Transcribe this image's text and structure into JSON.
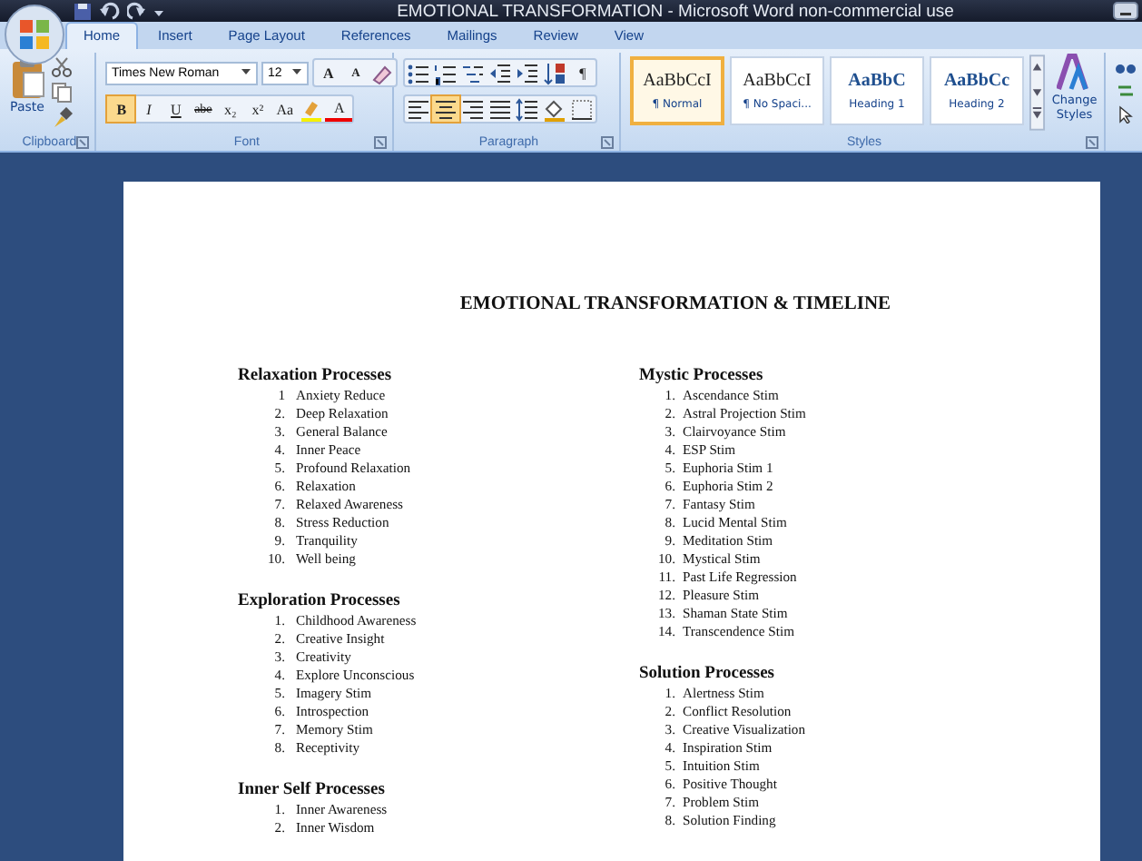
{
  "window": {
    "title": "EMOTIONAL TRANSFORMATION - Microsoft Word non-commercial use"
  },
  "tabs": [
    {
      "label": "Home",
      "selected": true
    },
    {
      "label": "Insert",
      "selected": false
    },
    {
      "label": "Page Layout",
      "selected": false
    },
    {
      "label": "References",
      "selected": false
    },
    {
      "label": "Mailings",
      "selected": false
    },
    {
      "label": "Review",
      "selected": false
    },
    {
      "label": "View",
      "selected": false
    }
  ],
  "ribbon": {
    "groups": [
      {
        "kind": "clipboard",
        "label": "Clipboard",
        "paste_label": "Paste"
      },
      {
        "kind": "font",
        "label": "Font",
        "font_name": "Times New Roman",
        "font_size": "12",
        "row1": [
          {
            "kind": "grow",
            "label": "A",
            "on": false
          },
          {
            "kind": "shrink",
            "label": "A",
            "on": false
          },
          {
            "kind": "clear",
            "on": false
          }
        ],
        "row2": [
          {
            "kind": "bold",
            "label": "B",
            "on": true
          },
          {
            "kind": "italic",
            "label": "I",
            "on": false
          },
          {
            "kind": "underline",
            "label": "U",
            "on": false
          },
          {
            "kind": "strike",
            "label": "abe",
            "on": false
          },
          {
            "kind": "sub",
            "label": "x₂",
            "on": false
          },
          {
            "kind": "sup",
            "label": "x²",
            "on": false
          },
          {
            "kind": "case",
            "label": "Aa",
            "on": false
          },
          {
            "kind": "highlight",
            "on": false
          },
          {
            "kind": "fontcolor",
            "label": "A",
            "on": false
          }
        ]
      },
      {
        "kind": "paragraph",
        "label": "Paragraph",
        "row1": [
          {
            "kind": "bullets",
            "on": false
          },
          {
            "kind": "numbering",
            "on": false
          },
          {
            "kind": "multilevel",
            "on": false
          },
          {
            "kind": "outdent",
            "on": false
          },
          {
            "kind": "indent",
            "on": false
          },
          {
            "kind": "sort",
            "on": false
          },
          {
            "kind": "pilcrow",
            "label": "¶",
            "on": false
          }
        ],
        "row2": [
          {
            "kind": "align-left",
            "on": false
          },
          {
            "kind": "align-center",
            "on": true
          },
          {
            "kind": "align-right",
            "on": false
          },
          {
            "kind": "justify",
            "on": false
          },
          {
            "kind": "spacing",
            "on": false
          },
          {
            "kind": "shading",
            "on": false
          },
          {
            "kind": "borders",
            "on": false
          }
        ]
      },
      {
        "kind": "styles",
        "label": "Styles",
        "styles": [
          {
            "preview": "AaBbCcI",
            "name": "¶ Normal",
            "selected": true
          },
          {
            "preview": "AaBbCcI",
            "name": "¶ No Spaci...",
            "selected": false
          },
          {
            "preview": "AaBbC",
            "name": "Heading 1",
            "selected": false
          },
          {
            "preview": "AaBbCc",
            "name": "Heading 2",
            "selected": false
          }
        ],
        "change_label": "Change Styles"
      }
    ]
  },
  "document": {
    "title": "EMOTIONAL TRANSFORMATION & TIMELINE",
    "columns": [
      [
        {
          "heading": "Relaxation Processes",
          "items": [
            {
              "number": "1",
              "text": "Anxiety Reduce"
            },
            {
              "number": "2.",
              "text": "Deep Relaxation"
            },
            {
              "number": "3.",
              "text": "General Balance"
            },
            {
              "number": "4.",
              "text": "Inner Peace"
            },
            {
              "number": "5.",
              "text": "Profound Relaxation"
            },
            {
              "number": "6.",
              "text": "Relaxation"
            },
            {
              "number": "7.",
              "text": "Relaxed Awareness"
            },
            {
              "number": "8.",
              "text": "Stress Reduction"
            },
            {
              "number": "9.",
              "text": "Tranquility"
            },
            {
              "number": "10.",
              "text": "Well being"
            }
          ]
        },
        {
          "heading": "Exploration Processes",
          "items": [
            {
              "number": "1.",
              "text": "Childhood Awareness"
            },
            {
              "number": "2.",
              "text": "Creative Insight"
            },
            {
              "number": "3.",
              "text": "Creativity"
            },
            {
              "number": "4.",
              "text": "Explore Unconscious"
            },
            {
              "number": "5.",
              "text": "Imagery Stim"
            },
            {
              "number": "6.",
              "text": "Introspection"
            },
            {
              "number": "7.",
              "text": "Memory Stim"
            },
            {
              "number": "8.",
              "text": "Receptivity"
            }
          ]
        },
        {
          "heading": "Inner Self Processes",
          "items": [
            {
              "number": "1.",
              "text": "Inner Awareness"
            },
            {
              "number": "2.",
              "text": "Inner Wisdom"
            }
          ]
        }
      ],
      [
        {
          "heading": "Mystic Processes",
          "items": [
            {
              "number": "1.",
              "text": "Ascendance Stim"
            },
            {
              "number": "2.",
              "text": "Astral Projection Stim"
            },
            {
              "number": "3.",
              "text": "Clairvoyance Stim"
            },
            {
              "number": "4.",
              "text": "ESP Stim"
            },
            {
              "number": "5.",
              "text": "Euphoria Stim 1"
            },
            {
              "number": "6.",
              "text": "Euphoria Stim 2"
            },
            {
              "number": "7.",
              "text": "Fantasy Stim"
            },
            {
              "number": "8.",
              "text": "Lucid Mental Stim"
            },
            {
              "number": "9.",
              "text": "Meditation Stim"
            },
            {
              "number": "10.",
              "text": "Mystical Stim"
            },
            {
              "number": "11.",
              "text": "Past Life Regression"
            },
            {
              "number": "12.",
              "text": "Pleasure Stim"
            },
            {
              "number": "13.",
              "text": "Shaman State Stim"
            },
            {
              "number": "14.",
              "text": "Transcendence Stim"
            }
          ]
        },
        {
          "heading": "Solution Processes",
          "items": [
            {
              "number": "1.",
              "text": "Alertness Stim"
            },
            {
              "number": "2.",
              "text": "Conflict Resolution"
            },
            {
              "number": "3.",
              "text": "Creative Visualization"
            },
            {
              "number": "4.",
              "text": "Inspiration Stim"
            },
            {
              "number": "5.",
              "text": "Intuition Stim"
            },
            {
              "number": "6.",
              "text": "Positive Thought"
            },
            {
              "number": "7.",
              "text": "Problem Stim"
            },
            {
              "number": "8.",
              "text": "Solution Finding"
            }
          ]
        }
      ]
    ]
  }
}
